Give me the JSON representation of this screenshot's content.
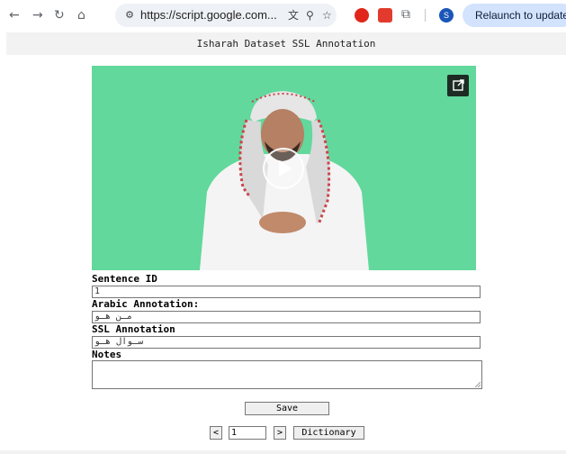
{
  "browser": {
    "url": "https://script.google.com...",
    "relaunch_label": "Relaunch to update",
    "profile_initial": "S"
  },
  "page": {
    "title": "Isharah Dataset SSL Annotation"
  },
  "form": {
    "sentence_id_label": "Sentence ID",
    "sentence_id_value": "1",
    "arabic_label": "Arabic Annotation:",
    "arabic_value": "مـن هـو",
    "ssl_label": "SSL Annotation",
    "ssl_value": "سـوال هـو",
    "notes_label": "Notes",
    "notes_value": ""
  },
  "actions": {
    "save_label": "Save",
    "prev_label": "<",
    "next_label": ">",
    "page_value": "1",
    "dictionary_label": "Dictionary"
  },
  "colors": {
    "video_background": "#5fd69a",
    "relaunch_bg": "#d3e3fd"
  },
  "icons": [
    "back-icon",
    "forward-icon",
    "reload-icon",
    "home-icon",
    "site-info-icon",
    "translate-icon",
    "zoom-icon",
    "bookmark-star-icon",
    "extension-icon",
    "play-icon",
    "open-external-icon"
  ]
}
